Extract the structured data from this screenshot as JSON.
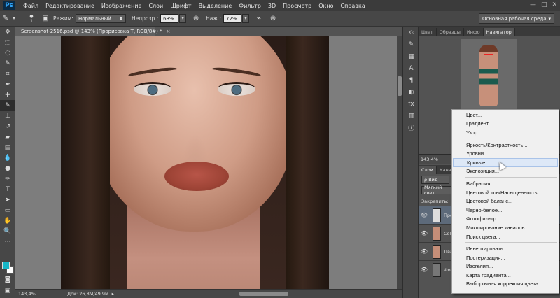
{
  "app": {
    "logo": "Ps"
  },
  "menubar": [
    "Файл",
    "Редактирование",
    "Изображение",
    "Слои",
    "Шрифт",
    "Выделение",
    "Фильтр",
    "3D",
    "Просмотр",
    "Окно",
    "Справка"
  ],
  "window_controls": {
    "minimize": "—",
    "maximize": "□",
    "close": "✕"
  },
  "options": {
    "brush_size": "1",
    "mode_label": "Режим:",
    "mode_value": "Нормальный",
    "opacity_label": "Непрозр.:",
    "opacity_value": "63%",
    "flow_label": "Наж.:",
    "flow_value": "72%",
    "workspace": "Основная рабочая среда"
  },
  "document": {
    "tab_title": "Screenshot-2516.psd @ 143% (Прорисовка Т, RGB/8#) *",
    "close": "×"
  },
  "status": {
    "zoom": "143,4%",
    "doc_size": "Док: 26,8M/49,9M"
  },
  "panels": {
    "top_tabs": [
      "Цвет",
      "Образцы",
      "Инфо",
      "Навигатор"
    ],
    "active_top_tab": "Навигатор",
    "nav_zoom": "143,4%",
    "layer_tabs": [
      "Слои",
      "Канал"
    ],
    "layer_filter": "Вид",
    "blend_mode": "Мягкий свет",
    "lock_label": "Закрепить:",
    "layers": [
      {
        "name": "Про"
      },
      {
        "name": "Colo"
      },
      {
        "name": "Два"
      },
      {
        "name": "Фон"
      }
    ]
  },
  "context_menu": {
    "highlighted": "Кривые...",
    "groups": [
      [
        "Цвет...",
        "Градиент...",
        "Узор..."
      ],
      [
        "Яркость/Контрастность...",
        "Уровни...",
        "Кривые...",
        "Экспозиция..."
      ],
      [
        "Вибрация...",
        "Цветовой тон/Насыщенность...",
        "Цветовой баланс...",
        "Черно-белое...",
        "Фотофильтр...",
        "Микширование каналов...",
        "Поиск цвета..."
      ],
      [
        "Инвертировать",
        "Постеризация...",
        "Изогелия...",
        "Карта градиента...",
        "Выборочная коррекция цвета..."
      ]
    ]
  },
  "colors": {
    "foreground": "#17b7c8",
    "background": "#ffffff",
    "accent": "#31a8ff"
  },
  "icons": {
    "tools": [
      "move-icon",
      "marquee-icon",
      "lasso-icon",
      "quick-select-icon",
      "crop-icon",
      "eyedropper-icon",
      "healing-icon",
      "brush-icon",
      "clone-stamp-icon",
      "history-brush-icon",
      "eraser-icon",
      "gradient-icon",
      "blur-icon",
      "dodge-icon",
      "pen-icon",
      "type-icon",
      "path-select-icon",
      "shape-icon",
      "hand-icon",
      "zoom-icon"
    ],
    "side_tools": [
      "history-icon",
      "brush-presets-icon",
      "properties-icon",
      "character-icon",
      "paragraph-icon",
      "adjustments-icon",
      "styles-icon",
      "swatches-icon"
    ]
  }
}
